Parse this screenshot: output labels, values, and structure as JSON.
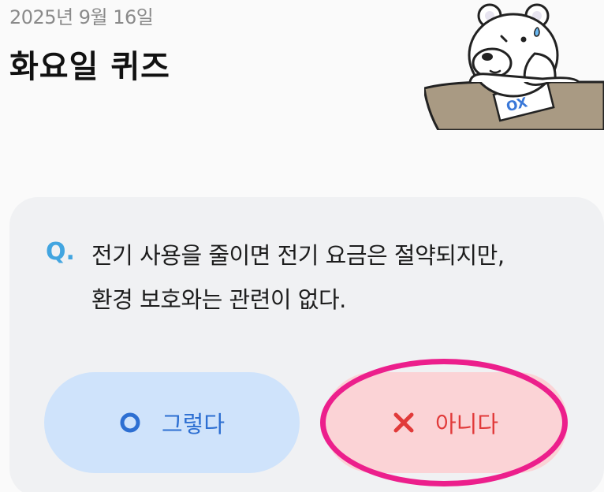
{
  "header": {
    "date": "2025년 9월 16일",
    "title": "화요일 퀴즈"
  },
  "illustration": {
    "name": "bear-thinking-over-ox-paper",
    "paper_text": "OX"
  },
  "quiz": {
    "q_label": "Q.",
    "question_line1": "전기 사용을 줄이면 전기 요금은 절약되지만,",
    "question_line2": "환경 보호와는 관련이 없다."
  },
  "answers": {
    "o_label": "그렇다",
    "x_label": "아니다",
    "o_icon": "circle-icon",
    "x_icon": "cross-icon",
    "o_color": "#2d6fd2",
    "x_color": "#e13a3a"
  },
  "colors": {
    "card_bg": "#f0f1f3",
    "o_button_bg": "#cfe3fb",
    "x_button_bg": "#fbd3d6",
    "highlight": "#ec1f8c",
    "q_accent": "#42a5e0"
  }
}
